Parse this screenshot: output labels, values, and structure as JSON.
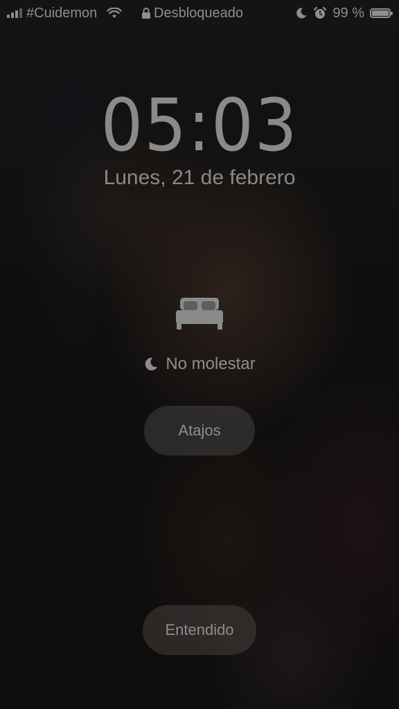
{
  "status_bar": {
    "carrier": "#Cuidemon",
    "lock_status": "Desbloqueado",
    "battery_percent": "99 %",
    "battery_level": 0.99,
    "icons": [
      "signal-icon",
      "wifi-icon",
      "lock-icon",
      "moon-icon",
      "alarm-icon",
      "battery-icon"
    ]
  },
  "lockscreen": {
    "time": "05:03",
    "date": "Lunes, 21 de febrero"
  },
  "focus": {
    "icon": "bed-icon",
    "label": "No molestar"
  },
  "buttons": {
    "shortcuts_label": "Atajos",
    "dismiss_label": "Entendido"
  }
}
